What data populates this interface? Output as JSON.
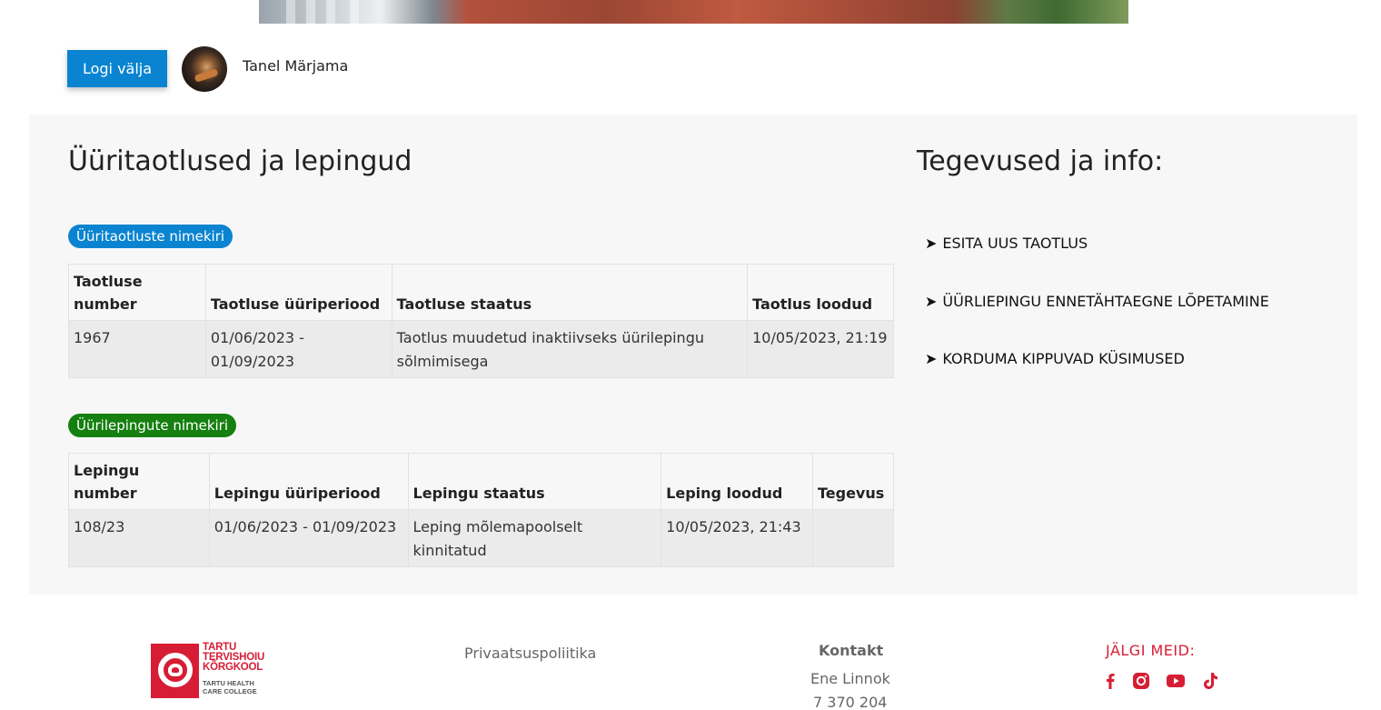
{
  "user": {
    "logout_label": "Logi välja",
    "name": "Tanel Märjama"
  },
  "main": {
    "title": "Üüritaotlused ja lepingud",
    "applications": {
      "badge": "Üüritaotluste nimekiri",
      "headers": [
        "Taotluse number",
        "Taotluse üüriperiood",
        "Taotluse staatus",
        "Taotlus loodud"
      ],
      "rows": [
        [
          "1967",
          "01/06/2023 - 01/09/2023",
          "Taotlus muudetud inaktiivseks üürilepingu sõlmimisega",
          "10/05/2023, 21:19"
        ]
      ]
    },
    "contracts": {
      "badge": "Üürilepingute nimekiri",
      "headers": [
        "Lepingu number",
        "Lepingu üüriperiood",
        "Lepingu staatus",
        "Leping loodud",
        "Tegevus"
      ],
      "rows": [
        [
          "108/23",
          "01/06/2023 - 01/09/2023",
          "Leping mõlemapoolselt kinnitatud",
          "10/05/2023, 21:43",
          ""
        ]
      ]
    }
  },
  "sidebar": {
    "title": "Tegevused ja info:",
    "arrow": "➤",
    "actions": [
      "ESITA UUS TAOTLUS",
      "ÜÜRLIEPINGU ENNETÄHTAEGNE LÕPETAMINE",
      "KORDUMA KIPPUVAD KÜSIMUSED"
    ]
  },
  "footer": {
    "logo_text": [
      "TARTU",
      "TERVISHOIU",
      "KÕRGKOOL"
    ],
    "logo_sub": [
      "TARTU HEALTH",
      "CARE COLLEGE"
    ],
    "privacy": "Privaatsuspoliitika",
    "contact_title": "Kontakt",
    "contact_name": "Ene Linnok",
    "contact_phone": "7 370 204",
    "follow": "JÄLGI MEID:",
    "social_icons": [
      "facebook-icon",
      "instagram-icon",
      "youtube-icon",
      "tiktok-icon"
    ],
    "brand_color": "#d71d35"
  },
  "colors": {
    "primary_blue": "#0a84d0",
    "green_badge": "#15800f",
    "panel_bg": "#f7f7f7"
  }
}
